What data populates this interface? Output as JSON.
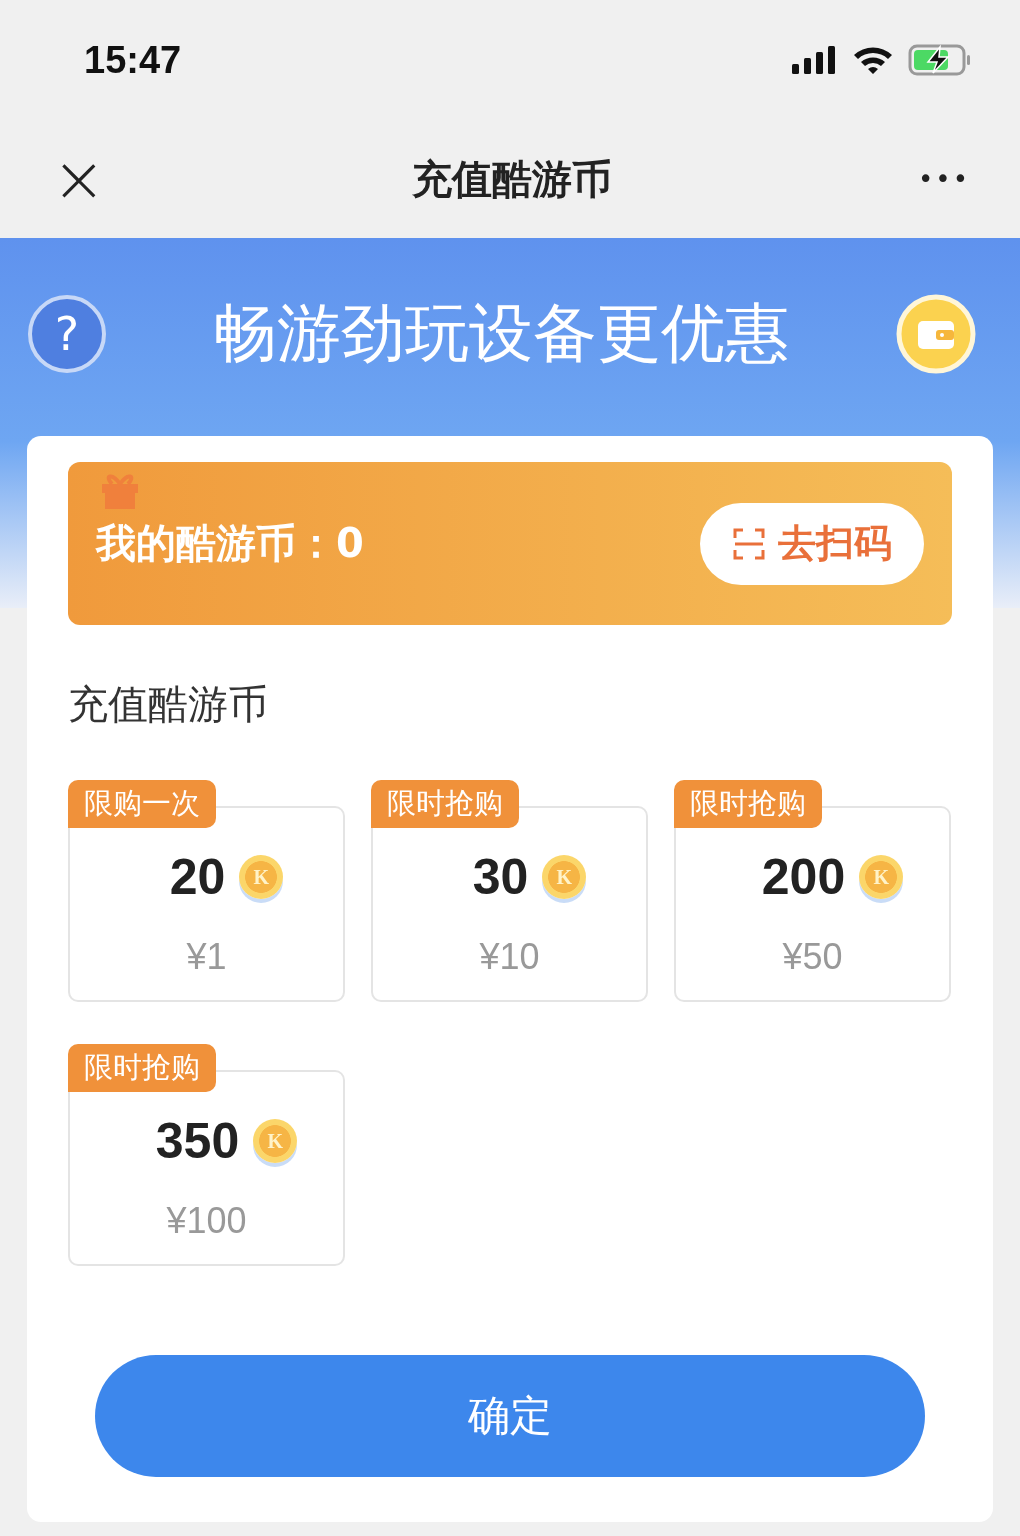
{
  "status_bar": {
    "time": "15:47",
    "battery_charging": true
  },
  "nav": {
    "close": "×",
    "title": "充值酷游币",
    "more": "•••"
  },
  "banner": {
    "help": "?",
    "title": "畅游劲玩设备更优惠"
  },
  "balance": {
    "label": "我的酷游币：",
    "value": "0",
    "scan_button": "去扫码"
  },
  "section_title": "充值酷游币",
  "packages": [
    {
      "tag": "限购一次",
      "amount": "20",
      "coin_mark": "K",
      "price": "¥1"
    },
    {
      "tag": "限时抢购",
      "amount": "30",
      "coin_mark": "K",
      "price": "¥10"
    },
    {
      "tag": "限时抢购",
      "amount": "200",
      "coin_mark": "K",
      "price": "¥50"
    },
    {
      "tag": "限时抢购",
      "amount": "350",
      "coin_mark": "K",
      "price": "¥100"
    }
  ],
  "confirm_button": "确定"
}
